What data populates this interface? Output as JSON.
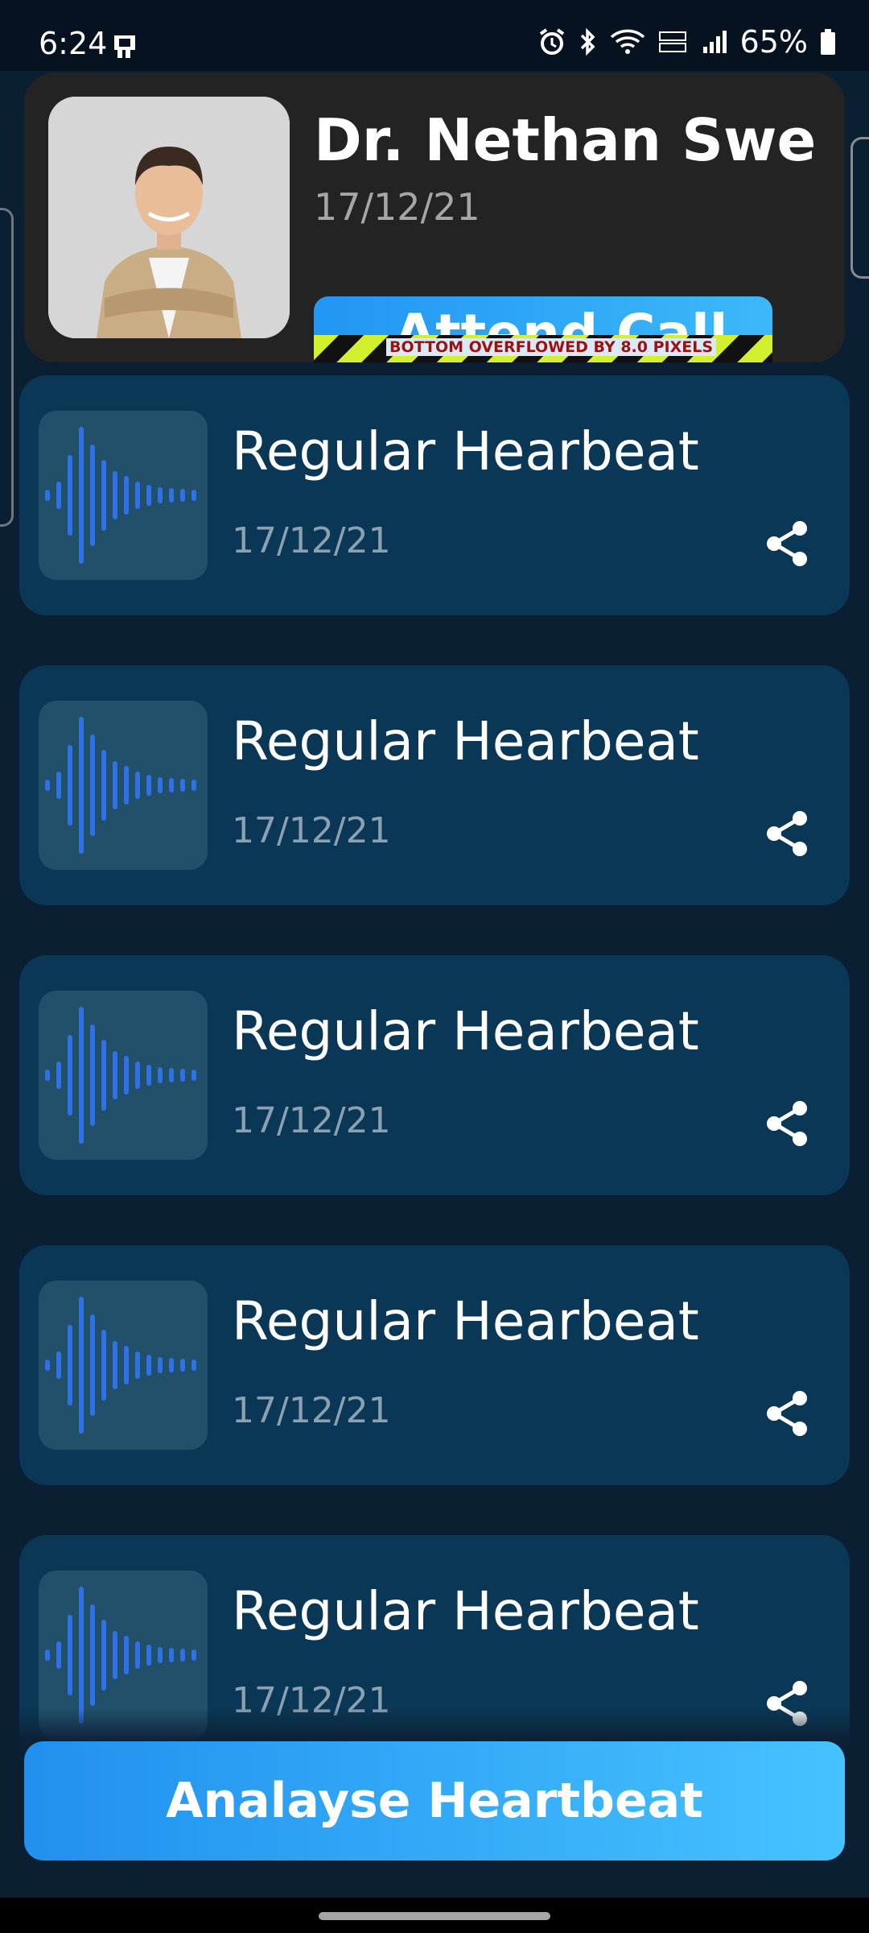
{
  "status_bar": {
    "time": "6:24",
    "battery": "65%",
    "icons": [
      "sim-card-icon",
      "alarm-icon",
      "bluetooth-icon",
      "wifi-icon",
      "volte-icon",
      "signal-icon",
      "battery-icon"
    ]
  },
  "call_card": {
    "name": "Dr. Nethan Swe",
    "date": "17/12/21",
    "attend_label": "Attend Call",
    "overflow_message": "BOTTOM OVERFLOWED BY 8.0 PIXELS"
  },
  "recordings": [
    {
      "title": "Regular Hearbeat",
      "date": "17/12/21"
    },
    {
      "title": "Regular Hearbeat",
      "date": "17/12/21"
    },
    {
      "title": "Regular Hearbeat",
      "date": "17/12/21"
    },
    {
      "title": "Regular Hearbeat",
      "date": "17/12/21"
    },
    {
      "title": "Regular Hearbeat",
      "date": "17/12/21"
    }
  ],
  "actions": {
    "analyse_label": "Analayse Heartbeat"
  },
  "colors": {
    "background": "#0b1f33",
    "card": "#0b3756",
    "wave": "#2f72e6",
    "accent": "#2196f3"
  }
}
